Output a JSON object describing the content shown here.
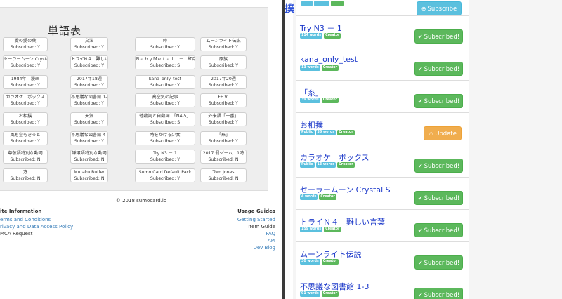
{
  "left": {
    "title": "単語表",
    "cards": [
      {
        "name": "愛の愛の葉",
        "sub": "Subscribed: Y"
      },
      {
        "name": "文法",
        "sub": "Subscribed: Y"
      },
      {
        "name": "時",
        "sub": "Subscribed: Y"
      },
      {
        "name": "ムーンライト伝説",
        "sub": "Subscribed: Y"
      },
      {
        "name": "セーラームーン Crystal S",
        "sub": "Subscribed: Y"
      },
      {
        "name": "トライN４　難しい言葉",
        "sub": "Subscribed: Y"
      },
      {
        "name": "ＢａｂｙＭｅｔａｌ　－　紅月",
        "sub": "Subscribed: S"
      },
      {
        "name": "原族",
        "sub": "Subscribed: Y"
      },
      {
        "name": "1984年　漫画",
        "sub": "Subscribed: Y"
      },
      {
        "name": "2017年18週",
        "sub": "Subscribed: Y"
      },
      {
        "name": "kana_only_test",
        "sub": "Subscribed: Y"
      },
      {
        "name": "2017年20週",
        "sub": "Subscribed: Y"
      },
      {
        "name": "カラオケ　ボックス",
        "sub": "Subscribed: Y"
      },
      {
        "name": "不思議な図書館 1-3",
        "sub": "Subscribed: Y"
      },
      {
        "name": "高空気の記事",
        "sub": "Subscribed: Y"
      },
      {
        "name": "FF VI",
        "sub": "Subscribed: Y"
      },
      {
        "name": "お相撲",
        "sub": "Subscribed: Y"
      },
      {
        "name": "天気",
        "sub": "Subscribed: Y"
      },
      {
        "name": "他動詞と自動詞　「N4-5」",
        "sub": "Subscribed: S"
      },
      {
        "name": "外来語「一番」",
        "sub": "Subscribed: Y"
      },
      {
        "name": "風も空もきっと",
        "sub": "Subscribed: Y"
      },
      {
        "name": "不思議な図書館 4-6",
        "sub": "Subscribed: Y"
      },
      {
        "name": "時をかける少女",
        "sub": "Subscribed: Y"
      },
      {
        "name": "「糸」",
        "sub": "Subscribed: Y"
      },
      {
        "name": "尊敬語特別な動詞",
        "sub": "Subscribed: N"
      },
      {
        "name": "謙譲語特別な動詞",
        "sub": "Subscribed: N"
      },
      {
        "name": "Try N3 － 1",
        "sub": "Subscribed: Y"
      },
      {
        "name": "2017 罰ゲーム　1時",
        "sub": "Subscribed: N"
      },
      {
        "name": "方",
        "sub": "Subscribed: N"
      },
      {
        "name": "Muraku Butler",
        "sub": "Subscribed: N"
      },
      {
        "name": "Sumo Card Default Pack",
        "sub": "Subscribed: Y"
      },
      {
        "name": "Tom Jones",
        "sub": "Subscribed: N"
      }
    ],
    "footer": {
      "copyright": "© 2018 sumocard.io",
      "site_info_title": "ite Information",
      "site_links": [
        "erms and Conditions",
        "rivacy and Data Access Policy",
        "MCA Request"
      ],
      "usage_title": "Usage Guides",
      "usage_links": [
        "Getting Started",
        "Item Guide",
        "FAQ",
        "API",
        "Dev Blog"
      ]
    }
  },
  "right": {
    "gutter_char": "撲",
    "top_button": "Subscribe",
    "subscribed_label": "Subscribed!",
    "update_label": "Update",
    "items": [
      {
        "title": "Try N3 － 1",
        "badges": [
          "114 words",
          "Creator"
        ],
        "action": "subscribed"
      },
      {
        "title": "kana_only_test",
        "badges": [
          "13 words",
          "Creator"
        ],
        "action": "subscribed"
      },
      {
        "title": "「糸」",
        "badges": [
          "39 words",
          "Creator"
        ],
        "action": "subscribed"
      },
      {
        "title": "お相撲",
        "badges": [
          "Public",
          "36 words",
          "Creator"
        ],
        "action": "update"
      },
      {
        "title": "カラオケ　ボックス",
        "badges": [
          "Public",
          "13 words",
          "Creator"
        ],
        "action": "subscribed"
      },
      {
        "title": "セーラームーン Crystal S",
        "badges": [
          "4 words",
          "Creator"
        ],
        "action": "subscribed"
      },
      {
        "title": "トライＮ４　難しい言葉",
        "badges": [
          "159 words",
          "Creator"
        ],
        "action": "subscribed"
      },
      {
        "title": "ムーンライト伝説",
        "badges": [
          "30 words",
          "Creator"
        ],
        "action": "subscribed"
      },
      {
        "title": "不思議な図書館 1-3",
        "badges": [
          "91 words",
          "Creator"
        ],
        "action": "subscribed"
      }
    ]
  }
}
